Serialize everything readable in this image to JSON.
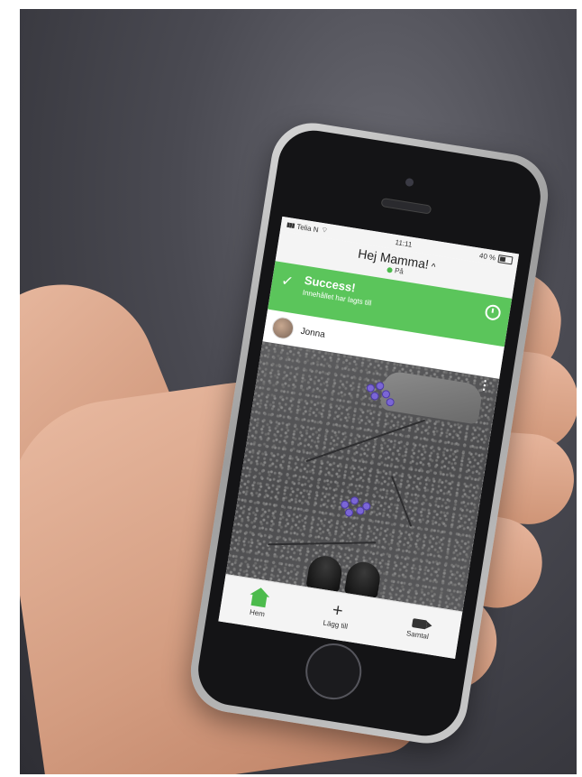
{
  "status_bar": {
    "carrier": "Telia N",
    "time": "11:11",
    "battery": "40 %"
  },
  "header": {
    "title": "Hej Mamma!",
    "chevron": "^",
    "status": "På"
  },
  "banner": {
    "title": "Success!",
    "message": "Innehållet har lagts till",
    "check_icon": "✓",
    "icon_right": "timer-icon"
  },
  "post": {
    "author": "Jonna",
    "more_icon": "⋮"
  },
  "tab_bar": {
    "items": [
      {
        "label": "Hem",
        "icon": "home-icon"
      },
      {
        "label": "Lägg till",
        "icon": "plus-icon",
        "glyph": "+"
      },
      {
        "label": "Samtal",
        "icon": "video-icon"
      }
    ]
  },
  "colors": {
    "accent": "#5bc55b",
    "status_dot": "#4cbb4c"
  }
}
